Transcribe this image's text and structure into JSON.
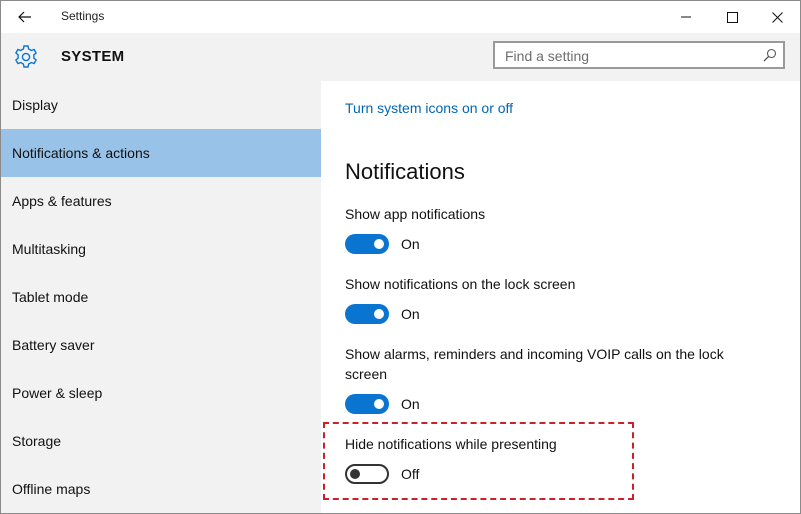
{
  "titlebar": {
    "title": "Settings",
    "back_icon": "back-arrow-icon",
    "minimize_icon": "minimize-icon",
    "maximize_icon": "maximize-icon",
    "close_icon": "close-icon"
  },
  "header": {
    "icon": "gear-icon",
    "label": "SYSTEM",
    "search": {
      "placeholder": "Find a setting",
      "icon": "search-icon"
    }
  },
  "sidebar": {
    "selected_color": "#99c2e8",
    "items": [
      {
        "label": "Display",
        "selected": false
      },
      {
        "label": "Notifications & actions",
        "selected": true
      },
      {
        "label": "Apps & features",
        "selected": false
      },
      {
        "label": "Multitasking",
        "selected": false
      },
      {
        "label": "Tablet mode",
        "selected": false
      },
      {
        "label": "Battery saver",
        "selected": false
      },
      {
        "label": "Power & sleep",
        "selected": false
      },
      {
        "label": "Storage",
        "selected": false
      },
      {
        "label": "Offline maps",
        "selected": false
      }
    ]
  },
  "content": {
    "link": "Turn system icons on or off",
    "section_title": "Notifications",
    "accent_color": "#0a74d1",
    "highlight_color": "#c8232c",
    "settings": [
      {
        "label": "Show app notifications",
        "state": "On"
      },
      {
        "label": "Show notifications on the lock screen",
        "state": "On"
      },
      {
        "label": "Show alarms, reminders and incoming VOIP calls on the lock screen",
        "state": "On"
      },
      {
        "label": "Hide notifications while presenting",
        "state": "Off"
      }
    ]
  }
}
